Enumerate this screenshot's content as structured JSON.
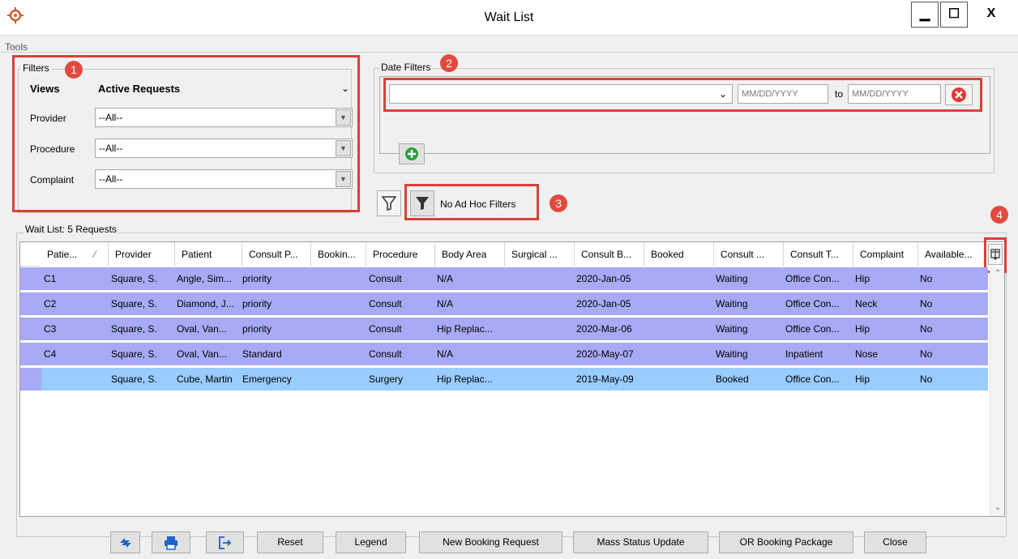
{
  "window": {
    "title": "Wait List",
    "minimize": "▁",
    "maximize": "☐",
    "close": "X"
  },
  "menu": {
    "tools": "Tools"
  },
  "filters": {
    "legend": "Filters",
    "badge": "1",
    "views_label": "Views",
    "views_value": "Active Requests",
    "provider_label": "Provider",
    "provider_value": "--All--",
    "procedure_label": "Procedure",
    "procedure_value": "--All--",
    "complaint_label": "Complaint",
    "complaint_value": "--All--"
  },
  "date_filters": {
    "legend": "Date Filters",
    "badge": "2",
    "range_value": "",
    "from_placeholder": "MM/DD/YYYY",
    "to_label": "to",
    "to_placeholder": "MM/DD/YYYY"
  },
  "adhoc": {
    "label": "No Ad Hoc Filters",
    "badge": "3"
  },
  "chooser": {
    "badge": "4"
  },
  "grid": {
    "legend": "Wait List: 5 Requests",
    "headers": [
      "Patie...",
      "Provider",
      "Patient",
      "Consult P...",
      "Bookin...",
      "Procedure",
      "Body Area",
      "Surgical ...",
      "Consult B...",
      "Booked",
      "Consult ...",
      "Consult T...",
      "Complaint",
      "Available..."
    ],
    "sort_glyph": "⁄",
    "rows": [
      [
        "C1",
        "Square, S.",
        "Angle, Sim...",
        "priority",
        "",
        "Consult",
        "N/A",
        "",
        "2020-Jan-05",
        "",
        "Waiting",
        "Office Con...",
        "Hip",
        "No"
      ],
      [
        "C2",
        "Square, S.",
        "Diamond, J...",
        "priority",
        "",
        "Consult",
        "N/A",
        "",
        "2020-Jan-05",
        "",
        "Waiting",
        "Office Con...",
        "Neck",
        "No"
      ],
      [
        "C3",
        "Square, S.",
        "Oval, Van...",
        "priority",
        "",
        "Consult",
        "Hip Replac...",
        "",
        "2020-Mar-06",
        "",
        "Waiting",
        "Office Con...",
        "Hip",
        "No"
      ],
      [
        "C4",
        "Square, S.",
        "Oval, Van...",
        "Standard",
        "",
        "Consult",
        "N/A",
        "",
        "2020-May-07",
        "",
        "Waiting",
        "Inpatient",
        "Nose",
        "No"
      ],
      [
        "",
        "Square, S.",
        "Cube, Martin",
        "Emergency",
        "",
        "Surgery",
        "Hip Replac...",
        "",
        "2019-May-09",
        "",
        "Booked",
        "Office Con...",
        "Hip",
        "No"
      ]
    ]
  },
  "buttons": {
    "reset": "Reset",
    "legend": "Legend",
    "new_booking": "New Booking Request",
    "mass_status": "Mass Status Update",
    "or_booking": "OR Booking Package",
    "close": "Close"
  }
}
